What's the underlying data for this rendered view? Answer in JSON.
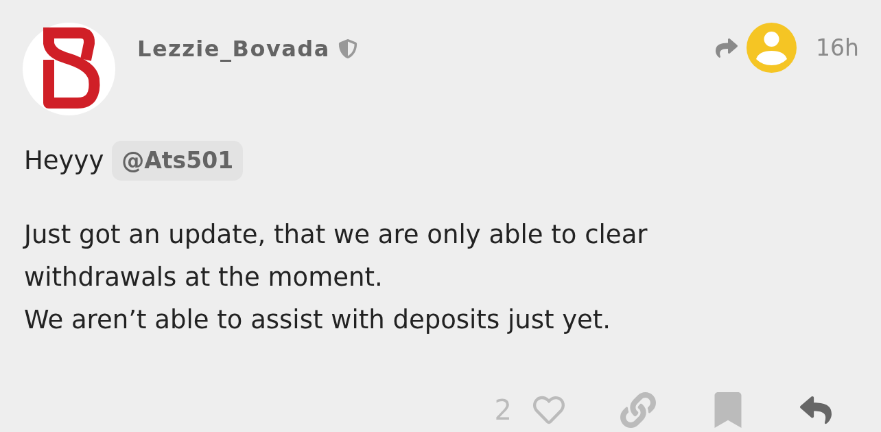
{
  "post": {
    "author": {
      "name": "Lezzie_Bovada"
    },
    "time": "16h",
    "greeting": {
      "text": "Heyyy",
      "mention": "@Ats501"
    },
    "paragraph": [
      "Just got an update, that we are only able to clear withdrawals at the moment.",
      "We aren’t able to assist with deposits just yet."
    ]
  },
  "actions": {
    "like_count": "2",
    "liked": false
  }
}
